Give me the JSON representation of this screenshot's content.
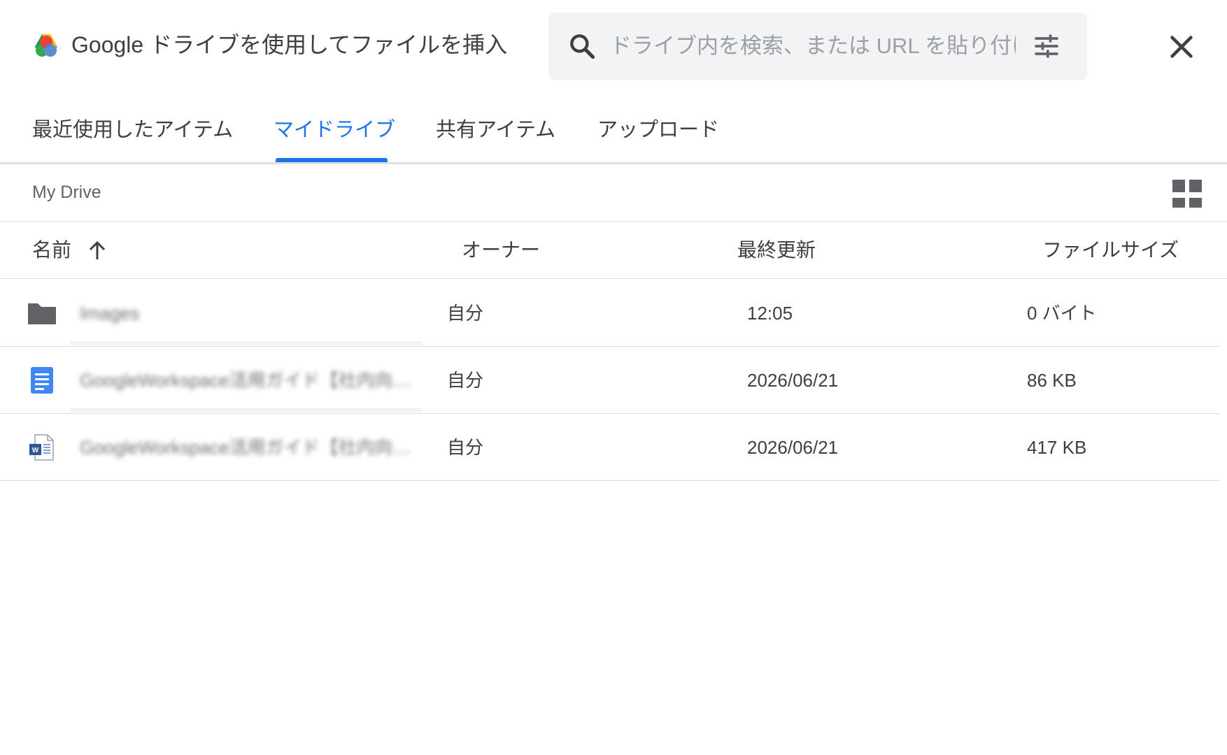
{
  "header": {
    "title": "Google ドライブを使用してファイルを挿入",
    "search_placeholder": "ドライブ内を検索、または URL を貼り付け",
    "search_value": ""
  },
  "tabs": [
    {
      "label": "最近使用したアイテム",
      "active": false
    },
    {
      "label": "マイドライブ",
      "active": true
    },
    {
      "label": "共有アイテム",
      "active": false
    },
    {
      "label": "アップロード",
      "active": false
    }
  ],
  "breadcrumb": "My Drive",
  "columns": {
    "name": "名前",
    "owner": "オーナー",
    "modified": "最終更新",
    "size": "ファイルサイズ"
  },
  "sort": {
    "column": "name",
    "direction": "ascending"
  },
  "files": [
    {
      "type": "folder",
      "icon": "folder-icon",
      "name": "Images",
      "owner": "自分",
      "modified": "12:05",
      "size": "0 バイト"
    },
    {
      "type": "google-doc",
      "icon": "google-docs-icon",
      "name": "GoogleWorkspace活用ガイド【社内向け】_最新版",
      "owner": "自分",
      "modified": "2026/06/21",
      "size": "86 KB"
    },
    {
      "type": "word-doc",
      "icon": "word-document-icon",
      "name": "GoogleWorkspace活用ガイド【社内向け】_最新版",
      "owner": "自分",
      "modified": "2026/06/21",
      "size": "417 KB"
    }
  ],
  "colors": {
    "accent": "#1a73e8",
    "text": "#3c4043",
    "muted": "#5f6368",
    "search_bg": "#f1f3f4",
    "divider": "#dadce0",
    "folder": "#5f6368",
    "docs_blue": "#4285f4",
    "word_blue": "#2b579a"
  }
}
